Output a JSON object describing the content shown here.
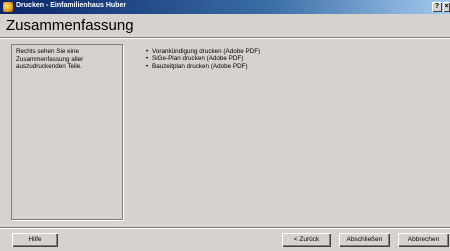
{
  "window": {
    "title": "Drucken - Einfamilienhaus Huber",
    "help_glyph": "?",
    "close_glyph": "×"
  },
  "page": {
    "title": "Zusammenfassung"
  },
  "info_panel": {
    "text": "Rechts sehen Sie eine Zusammenfassung aller auszudruckenden Teile."
  },
  "summary": {
    "bullet": "•",
    "items": [
      "Vorankündigung drucken (Adobe PDF)",
      "SiGe-Plan drucken (Adobe PDF)",
      "Bauzeitplan drucken (Adobe PDF)"
    ]
  },
  "buttons": {
    "help": "Hilfe",
    "back": "< Zurück",
    "finish": "Abschließen",
    "cancel": "Abbrechen"
  },
  "colors": {
    "title_bar_start": "#0a246a",
    "title_bar_end": "#a6caf0",
    "dialog_background": "#d6d3ce"
  },
  "icons": {
    "app": "app-icon"
  }
}
